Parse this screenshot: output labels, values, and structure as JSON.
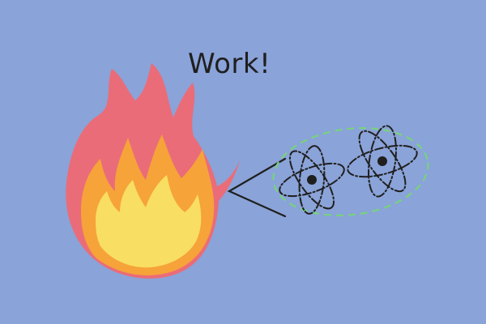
{
  "caption": {
    "text": "Work!"
  },
  "colors": {
    "background": "#8aa3d8",
    "flame_outer": "#ea6c78",
    "flame_middle": "#f6a33a",
    "flame_inner": "#f8de62",
    "ink": "#1f1f1f",
    "dashed_outline": "#78d27d"
  },
  "icons": {
    "fire": "fire-icon",
    "atom_a": "atom-icon",
    "atom_b": "atom-icon",
    "pointer": "triangle-pointer-icon",
    "cluster": "dashed-ellipse-icon"
  }
}
